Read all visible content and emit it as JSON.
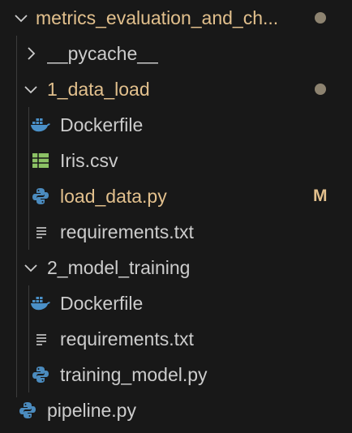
{
  "colors": {
    "background": "#181818",
    "text": "#cccccc",
    "modified": "#e2c08d",
    "dot": "#8d8370",
    "docker": "#4a90c8",
    "csv": "#8cc265",
    "python": "#4b8bbe",
    "text_file": "#cccccc"
  },
  "tree": {
    "root": {
      "label": "metrics_evaluation_and_ch...",
      "icon": "chevron-down-icon",
      "status": "modified"
    },
    "pycache": {
      "label": "__pycache__",
      "icon": "chevron-right-icon"
    },
    "data_load": {
      "label": "1_data_load",
      "icon": "chevron-down-icon",
      "status": "modified",
      "files": [
        {
          "label": "Dockerfile",
          "icon": "docker-icon"
        },
        {
          "label": "Iris.csv",
          "icon": "csv-icon"
        },
        {
          "label": "load_data.py",
          "icon": "python-icon",
          "badge": "M"
        },
        {
          "label": "requirements.txt",
          "icon": "text-file-icon"
        }
      ]
    },
    "model_training": {
      "label": "2_model_training",
      "icon": "chevron-down-icon",
      "files": [
        {
          "label": "Dockerfile",
          "icon": "docker-icon"
        },
        {
          "label": "requirements.txt",
          "icon": "text-file-icon"
        },
        {
          "label": "training_model.py",
          "icon": "python-icon"
        }
      ]
    },
    "pipeline": {
      "label": "pipeline.py",
      "icon": "python-icon"
    }
  }
}
